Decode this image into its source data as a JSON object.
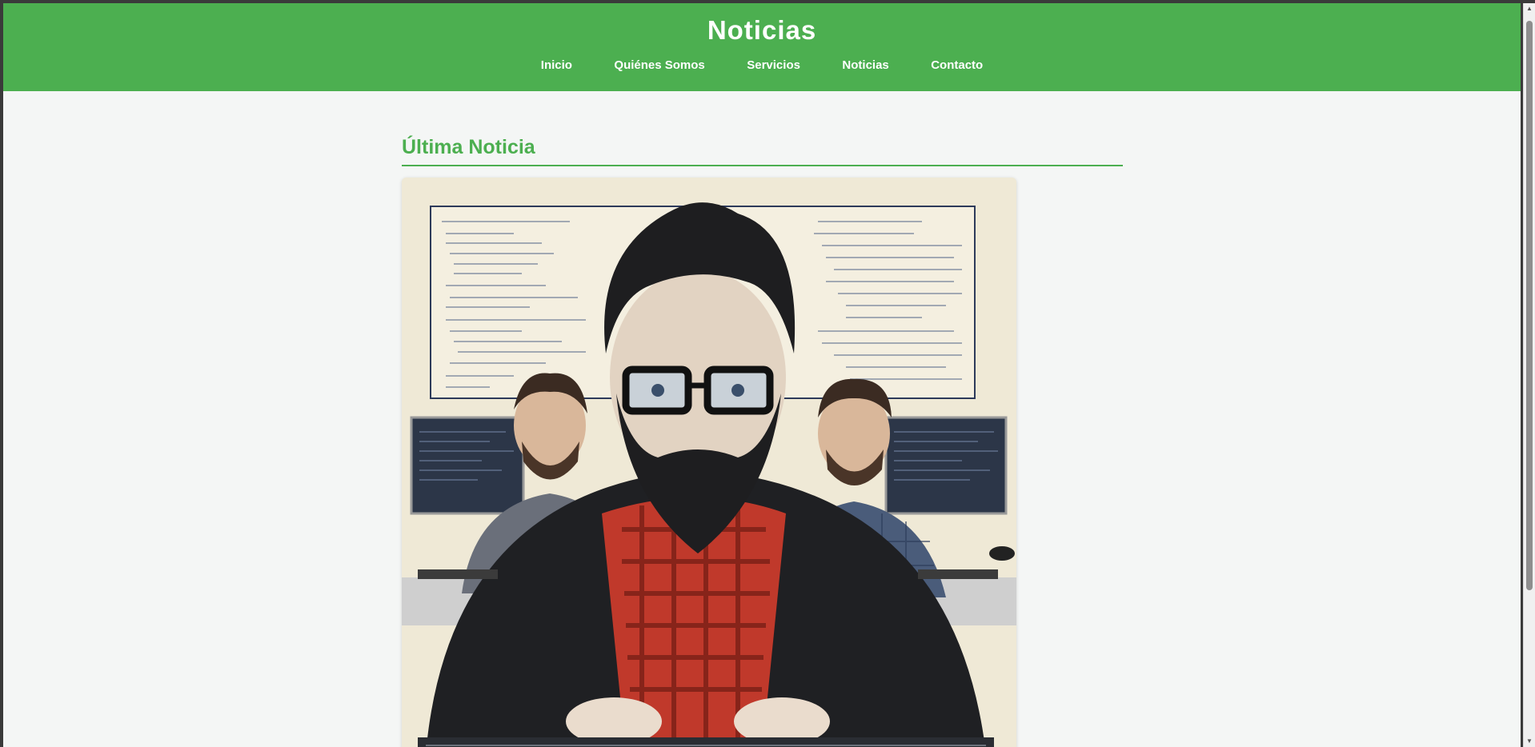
{
  "header": {
    "title": "Noticias",
    "nav": [
      "Inicio",
      "Quiénes Somos",
      "Servicios",
      "Noticias",
      "Contacto"
    ]
  },
  "main": {
    "section_title": "Última Noticia",
    "image_alt": "Ilustración de programadores con barba y gafas frente a pantallas de código"
  },
  "colors": {
    "brand_green": "#4caf50",
    "page_bg": "#f4f6f5"
  },
  "icons": {
    "scroll_up": "scroll-up-arrow-icon",
    "scroll_down": "scroll-down-arrow-icon"
  }
}
